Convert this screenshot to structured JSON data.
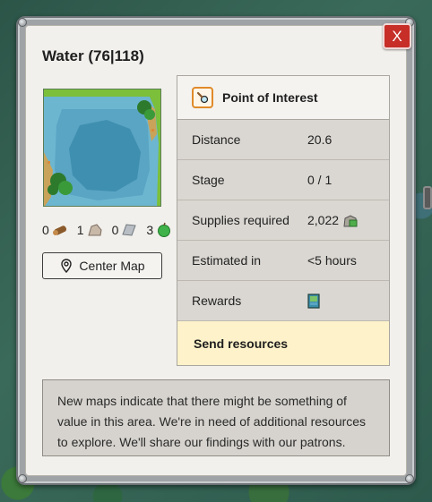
{
  "dialog": {
    "title": "Water (76|118)",
    "close_label": "X"
  },
  "resources": [
    {
      "count": "0",
      "icon": "wood-log-icon"
    },
    {
      "count": "1",
      "icon": "stone-icon"
    },
    {
      "count": "0",
      "icon": "metal-ingot-icon"
    },
    {
      "count": "3",
      "icon": "green-fruit-icon"
    }
  ],
  "center_map": {
    "label": "Center Map",
    "icon": "location-pin-icon"
  },
  "info": {
    "header": "Point of Interest",
    "header_icon": "magnifier-icon",
    "rows": [
      {
        "label": "Distance",
        "value": "20.6"
      },
      {
        "label": "Stage",
        "value": "0 / 1"
      },
      {
        "label": "Supplies required",
        "value": "2,022",
        "icon": "supplies-icon"
      },
      {
        "label": "Estimated in",
        "value": "<5 hours"
      },
      {
        "label": "Rewards",
        "value": "",
        "icon": "map-scroll-icon"
      }
    ],
    "send_label": "Send resources"
  },
  "description": "New maps indicate that there might be something of value in this area. We're in need of additional resources to explore. We'll share our findings with our patrons.",
  "colors": {
    "close_button": "#c62e27",
    "send_row_bg": "#fdf2c9",
    "poi_icon_border": "#e08a2a",
    "water": "#3f8fb0",
    "shallow_water": "#6cb6d0",
    "grass": "#7cbf3a"
  }
}
